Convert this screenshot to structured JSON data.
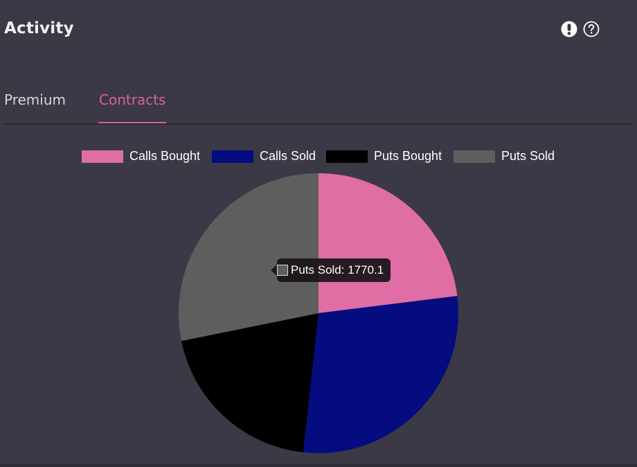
{
  "header": {
    "title": "Activity",
    "icons": [
      "alert-icon",
      "help-icon"
    ]
  },
  "tabs": [
    {
      "label": "Premium",
      "active": false
    },
    {
      "label": "Contracts",
      "active": true
    }
  ],
  "colors": {
    "background": "#3a3945",
    "accent": "#d9639b"
  },
  "chart_data": {
    "type": "pie",
    "categories": [
      "Calls Bought",
      "Calls Sold",
      "Puts Bought",
      "Puts Sold"
    ],
    "values": [
      1447,
      1803,
      1261,
      1770.1
    ],
    "colors": [
      "#df6ea5",
      "#050c80",
      "#000000",
      "#5e5e5e"
    ],
    "legend_position": "top",
    "tooltip": {
      "label": "Puts Sold",
      "value": "1770.1",
      "text": "Puts Sold: 1770.1"
    }
  }
}
